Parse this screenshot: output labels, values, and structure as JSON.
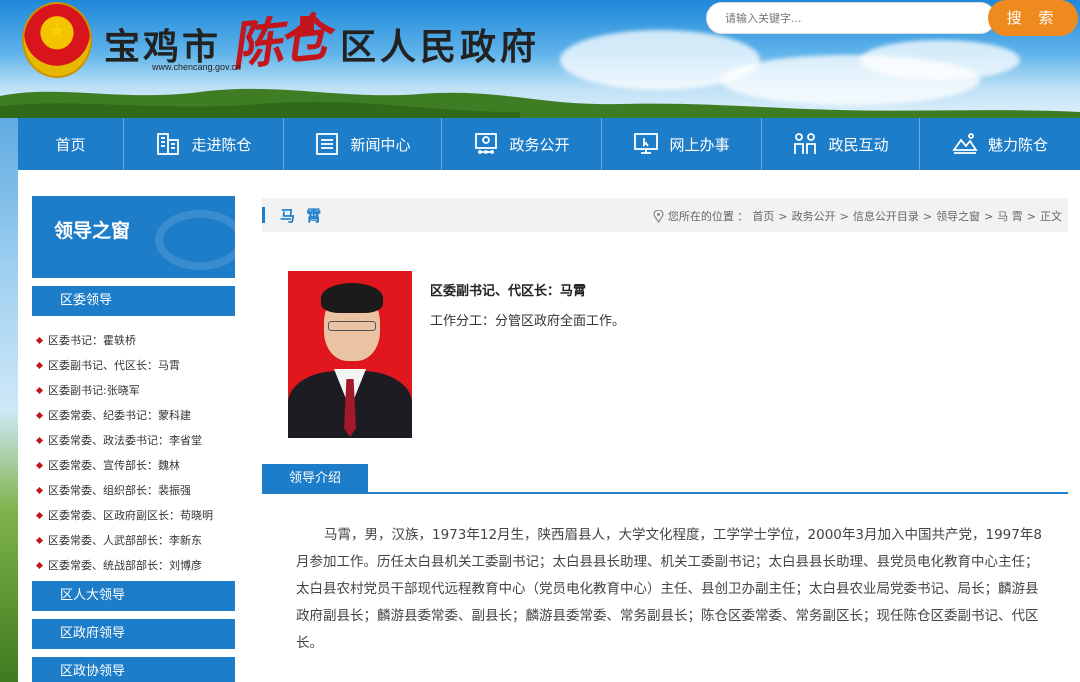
{
  "header": {
    "city": "宝鸡市",
    "district_calligraphy": "陈仓",
    "government": "区人民政府",
    "url": "www.chencang.gov.cn",
    "search_placeholder": "请输入关键字...",
    "search_button": "搜 索"
  },
  "nav": [
    {
      "label": "首页",
      "icon": ""
    },
    {
      "label": "走进陈仓",
      "icon": "building-icon"
    },
    {
      "label": "新闻中心",
      "icon": "newspaper-icon"
    },
    {
      "label": "政务公开",
      "icon": "monitor-people-icon"
    },
    {
      "label": "网上办事",
      "icon": "computer-cursor-icon"
    },
    {
      "label": "政民互动",
      "icon": "two-people-icon"
    },
    {
      "label": "魅力陈仓",
      "icon": "landscape-icon"
    }
  ],
  "sidebar": {
    "heading": "领导之窗",
    "categories": [
      "区委领导",
      "区人大领导",
      "区政府领导",
      "区政协领导"
    ],
    "leaders": [
      "区委书记：霍轶桥",
      "区委副书记、代区长：马霄",
      "区委副书记:张晓军",
      "区委常委、纪委书记：蒙科建",
      "区委常委、政法委书记：李省堂",
      "区委常委、宣传部长：魏林",
      "区委常委、组织部长：裴振强",
      "区委常委、区政府副区长：苟晓明",
      "区委常委、人武部部长：李新东",
      "区委常委、统战部部长：刘博彦"
    ]
  },
  "content": {
    "name": "马 霄",
    "breadcrumb": {
      "prefix": "您所在的位置 ：",
      "items": [
        "首页",
        "政务公开",
        "信息公开目录",
        "领导之窗",
        "马 霄",
        "正文"
      ]
    },
    "position": "区委副书记、代区长：马霄",
    "duty": "工作分工：分管区政府全面工作。",
    "section_tab": "领导介绍",
    "bio": "马霄，男，汉族，1973年12月生，陕西眉县人，大学文化程度，工学学士学位，2000年3月加入中国共产党，1997年8月参加工作。历任太白县机关工委副书记；太白县县长助理、机关工委副书记；太白县县长助理、县党员电化教育中心主任；太白县农村党员干部现代远程教育中心（党员电化教育中心）主任、县创卫办副主任；太白县农业局党委书记、局长；麟游县政府副县长；麟游县委常委、副县长；麟游县委常委、常务副县长；陈仓区委常委、常务副区长；现任陈仓区委副书记、代区长。"
  },
  "colors": {
    "primary_blue": "#1e7dc9",
    "search_orange": "#ef8b1e",
    "accent_red": "#c3161c"
  }
}
